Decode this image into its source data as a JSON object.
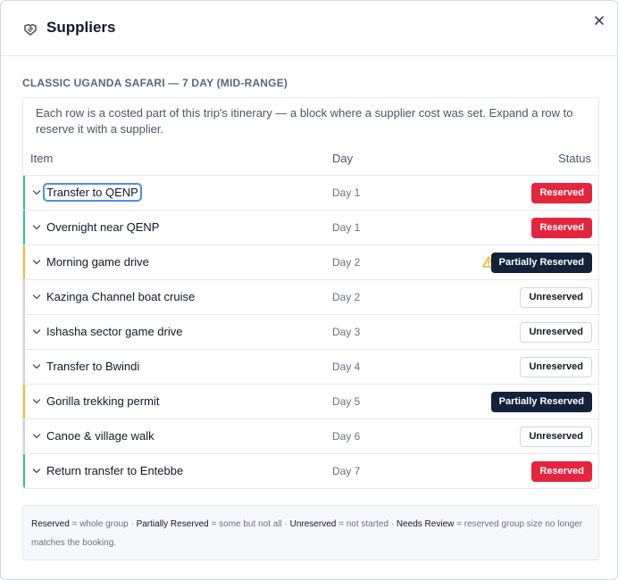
{
  "header": {
    "title": "Suppliers",
    "icon": "handshake-icon",
    "close_icon": "close-icon"
  },
  "trip_title": "CLASSIC UGANDA SAFARI — 7 DAY (MID-RANGE)",
  "intro": "Each row is a costed part of this trip's itinerary — a block where a supplier cost was set. Expand a row to reserve it with a supplier.",
  "columns": {
    "item": "Item",
    "day": "Day",
    "status": "Status"
  },
  "rows": [
    {
      "item": "Transfer to QENP",
      "day": "Day 1",
      "status": "Reserved",
      "focused": true
    },
    {
      "item": "Overnight near QENP",
      "day": "Day 1",
      "status": "Reserved"
    },
    {
      "item": "Morning game drive",
      "day": "Day 2",
      "status": "Partially Reserved",
      "warning": true
    },
    {
      "item": "Kazinga Channel boat cruise",
      "day": "Day 2",
      "status": "Unreserved"
    },
    {
      "item": "Ishasha sector game drive",
      "day": "Day 3",
      "status": "Unreserved"
    },
    {
      "item": "Transfer to Bwindi",
      "day": "Day 4",
      "status": "Unreserved"
    },
    {
      "item": "Gorilla trekking permit",
      "day": "Day 5",
      "status": "Partially Reserved"
    },
    {
      "item": "Canoe & village walk",
      "day": "Day 6",
      "status": "Unreserved"
    },
    {
      "item": "Return transfer to Entebbe",
      "day": "Day 7",
      "status": "Reserved"
    }
  ],
  "status_colors": {
    "Reserved": "#e5253d",
    "Partially Reserved": "#13213b",
    "Unreserved": "#ffffff",
    "reserved_bar": "#34c38f",
    "partial_bar": "#f5b82e",
    "unreserved_bar": "#d1d5db"
  },
  "legend": [
    {
      "term": "Reserved",
      "desc": " = whole group · "
    },
    {
      "term": "Partially Reserved",
      "desc": " = some but not all · "
    },
    {
      "term": "Unreserved",
      "desc": " = not started · "
    },
    {
      "term": "Needs Review",
      "desc": " = reserved group size no longer matches the booking."
    }
  ]
}
